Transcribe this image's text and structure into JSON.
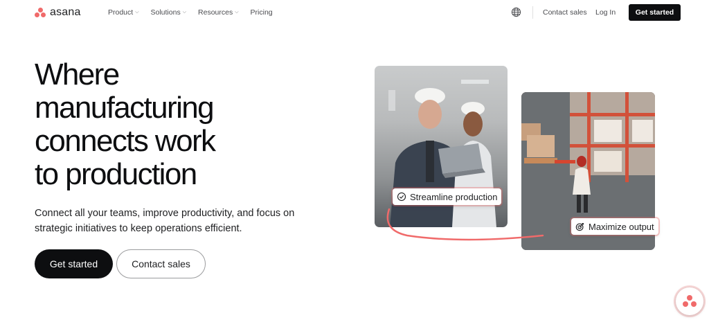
{
  "nav": {
    "logo_text": "asana",
    "links": [
      {
        "label": "Product",
        "has_dropdown": true
      },
      {
        "label": "Solutions",
        "has_dropdown": true
      },
      {
        "label": "Resources",
        "has_dropdown": true
      },
      {
        "label": "Pricing",
        "has_dropdown": false
      }
    ],
    "contact_sales": "Contact sales",
    "login": "Log In",
    "cta": "Get started",
    "globe_icon": "globe-icon"
  },
  "hero": {
    "headline_lines": [
      "Where",
      "manufacturing",
      "connects work",
      "to production"
    ],
    "subtext": "Connect all your teams, improve productivity, and focus on strategic initiatives to keep operations efficient.",
    "primary_button": "Get started",
    "secondary_button": "Contact sales"
  },
  "visual": {
    "tag_a": {
      "label": "Streamline production",
      "icon": "check-circle-icon"
    },
    "tag_b": {
      "label": "Maximize output",
      "icon": "target-icon"
    },
    "accent_color": "#f06a6a"
  },
  "chat": {
    "icon": "asana-logo-icon"
  },
  "colors": {
    "brand": "#f06a6a",
    "dark": "#0d0e10",
    "text": "#1e1f21"
  }
}
